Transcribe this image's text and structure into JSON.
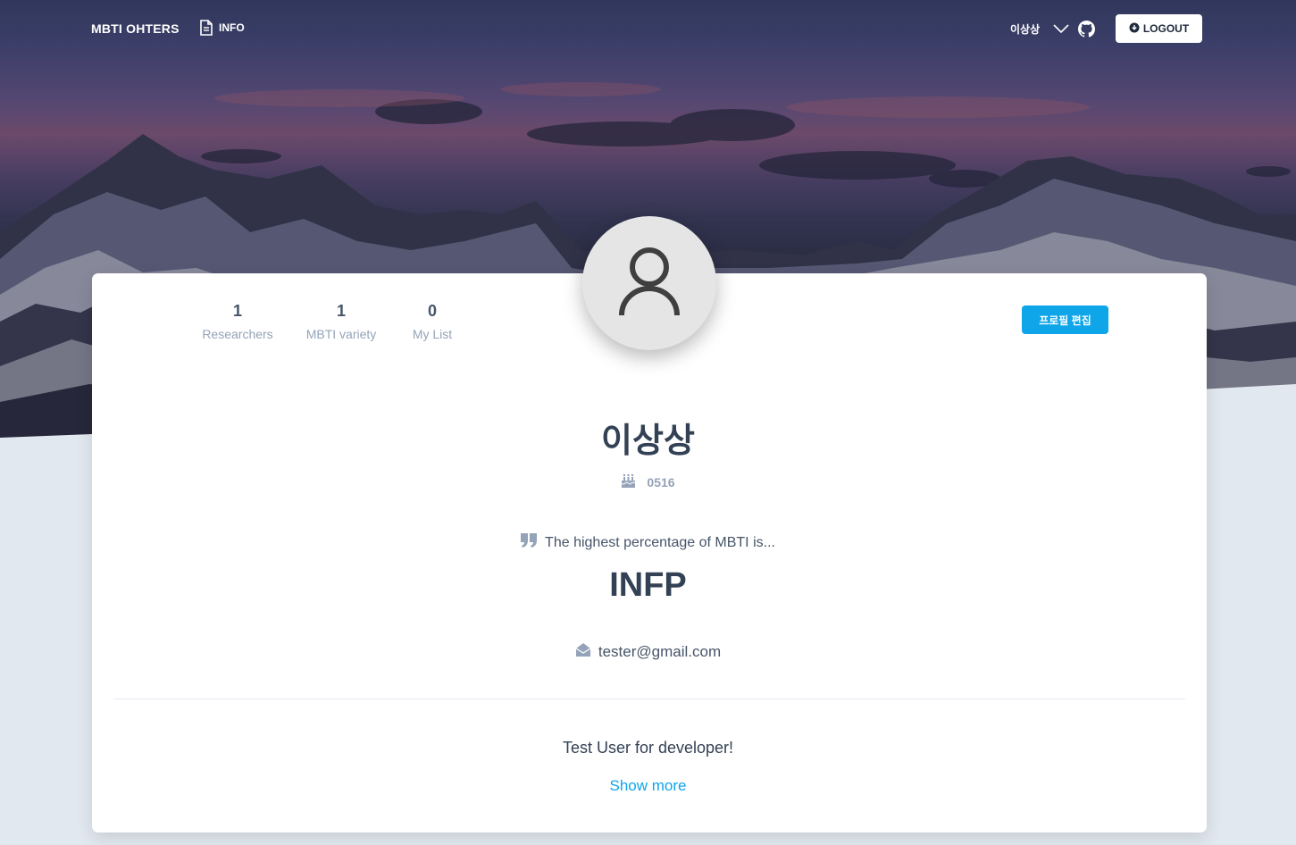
{
  "nav": {
    "brand": "MBTI OHTERS",
    "info_label": "INFO",
    "user_name": "이상상",
    "logout_label": "LOGOUT"
  },
  "profile": {
    "stats": [
      {
        "value": "1",
        "label": "Researchers"
      },
      {
        "value": "1",
        "label": "MBTI variety"
      },
      {
        "value": "0",
        "label": "My List"
      }
    ],
    "edit_label": "프로필 편집",
    "name": "이상상",
    "birthday": "0516",
    "quote": "The highest percentage of MBTI is...",
    "mbti": "INFP",
    "email": "tester@gmail.com",
    "bio": "Test User for developer!",
    "show_more": "Show more"
  },
  "colors": {
    "accent": "#0ea5e9",
    "page_bg": "#e2e8f0",
    "heading": "#334155",
    "muted": "#94a3b8"
  },
  "icons": [
    "file-icon",
    "chevron-down-icon",
    "github-icon",
    "download-circle-icon",
    "user-avatar-icon",
    "birthday-cake-icon",
    "quote-icon",
    "envelope-open-icon"
  ]
}
